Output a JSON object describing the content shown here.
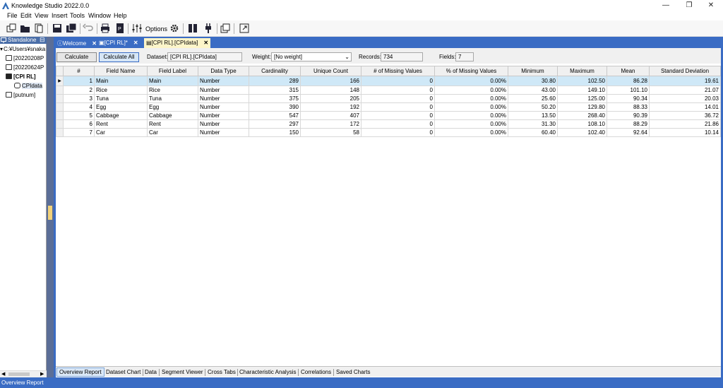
{
  "app": {
    "title": "Knowledge Studio 2022.0.0",
    "window_buttons": [
      "—",
      "❐",
      "✕"
    ]
  },
  "menu": [
    "File",
    "Edit",
    "View",
    "Insert",
    "Tools",
    "Window",
    "Help"
  ],
  "toolbar": {
    "options_label": "Options"
  },
  "left_panel": {
    "header": "Standalone",
    "tree": [
      {
        "label": "C:¥Users¥snaka"
      },
      {
        "label": "[20220208P"
      },
      {
        "label": "[20220624P"
      },
      {
        "label": "[CPI RL]"
      },
      {
        "label": "CPIdata"
      },
      {
        "label": "[putnum]"
      }
    ]
  },
  "doc_tabs": [
    {
      "label": "Welcome",
      "close": "✕"
    },
    {
      "label": "[CPI RL]*",
      "close": "✕"
    },
    {
      "label": "[CPI RL].[CPIdata]",
      "close": "✕"
    }
  ],
  "controls": {
    "calculate": "Calculate",
    "calculate_all": "Calculate All",
    "dataset_label": "Dataset:",
    "dataset_value": "[CPI RL].[CPIdata]",
    "weight_label": "Weight:",
    "weight_value": "[No weight]",
    "records_label": "Records:",
    "records_value": "734",
    "fields_label": "Fields:",
    "fields_value": "7"
  },
  "table": {
    "columns": [
      "#",
      "Field Name",
      "Field Label",
      "Data Type",
      "Cardinality",
      "Unique Count",
      "# of Missing Values",
      "% of Missing Values",
      "Minimum",
      "Maximum",
      "Mean",
      "Standard Deviation"
    ],
    "rows": [
      [
        "1",
        "Main",
        "Main",
        "Number",
        "289",
        "166",
        "0",
        "0.00%",
        "30.80",
        "102.50",
        "86.28",
        "19.61"
      ],
      [
        "2",
        "Rice",
        "Rice",
        "Number",
        "315",
        "148",
        "0",
        "0.00%",
        "43.00",
        "149.10",
        "101.10",
        "21.07"
      ],
      [
        "3",
        "Tuna",
        "Tuna",
        "Number",
        "375",
        "205",
        "0",
        "0.00%",
        "25.60",
        "125.00",
        "90.34",
        "20.03"
      ],
      [
        "4",
        "Egg",
        "Egg",
        "Number",
        "390",
        "192",
        "0",
        "0.00%",
        "50.20",
        "129.80",
        "88.33",
        "14.01"
      ],
      [
        "5",
        "Cabbage",
        "Cabbage",
        "Number",
        "547",
        "407",
        "0",
        "0.00%",
        "13.50",
        "268.40",
        "90.39",
        "36.72"
      ],
      [
        "6",
        "Rent",
        "Rent",
        "Number",
        "297",
        "172",
        "0",
        "0.00%",
        "31.30",
        "108.10",
        "88.29",
        "21.86"
      ],
      [
        "7",
        "Car",
        "Car",
        "Number",
        "150",
        "58",
        "0",
        "0.00%",
        "60.40",
        "102.40",
        "92.64",
        "10.14"
      ]
    ],
    "selected_row": 0
  },
  "bottom_tabs": [
    "Overview Report",
    "Dataset Chart",
    "Data",
    "Segment Viewer",
    "Cross Tabs",
    "Characteristic Analysis",
    "Correlations",
    "Saved Charts"
  ],
  "status": "Overview Report",
  "colors": {
    "accent": "#3a6cc4",
    "active_tab": "#fdf5c9",
    "selected_row": "#cfe8f7"
  }
}
